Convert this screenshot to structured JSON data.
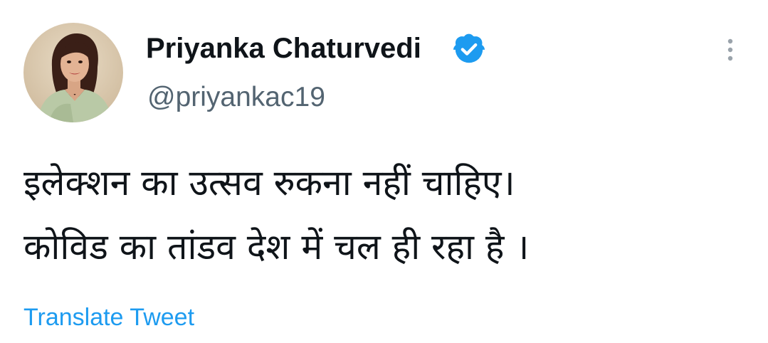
{
  "tweet": {
    "author": {
      "display_name": "Priyanka Chaturvedi",
      "handle": "@priyankac19",
      "verified": true,
      "avatar_icon": "profile-photo"
    },
    "more_icon": "more-vertical-icon",
    "text_lines": [
      "इलेक्शन का उत्सव रुकना नहीं चाहिए।",
      "कोविड का तांडव देश में चल ही रहा है ।"
    ],
    "translate_label": "Translate Tweet"
  },
  "colors": {
    "text_primary": "#0f1419",
    "text_secondary": "#536471",
    "accent": "#1d9bf0",
    "background": "#ffffff"
  }
}
